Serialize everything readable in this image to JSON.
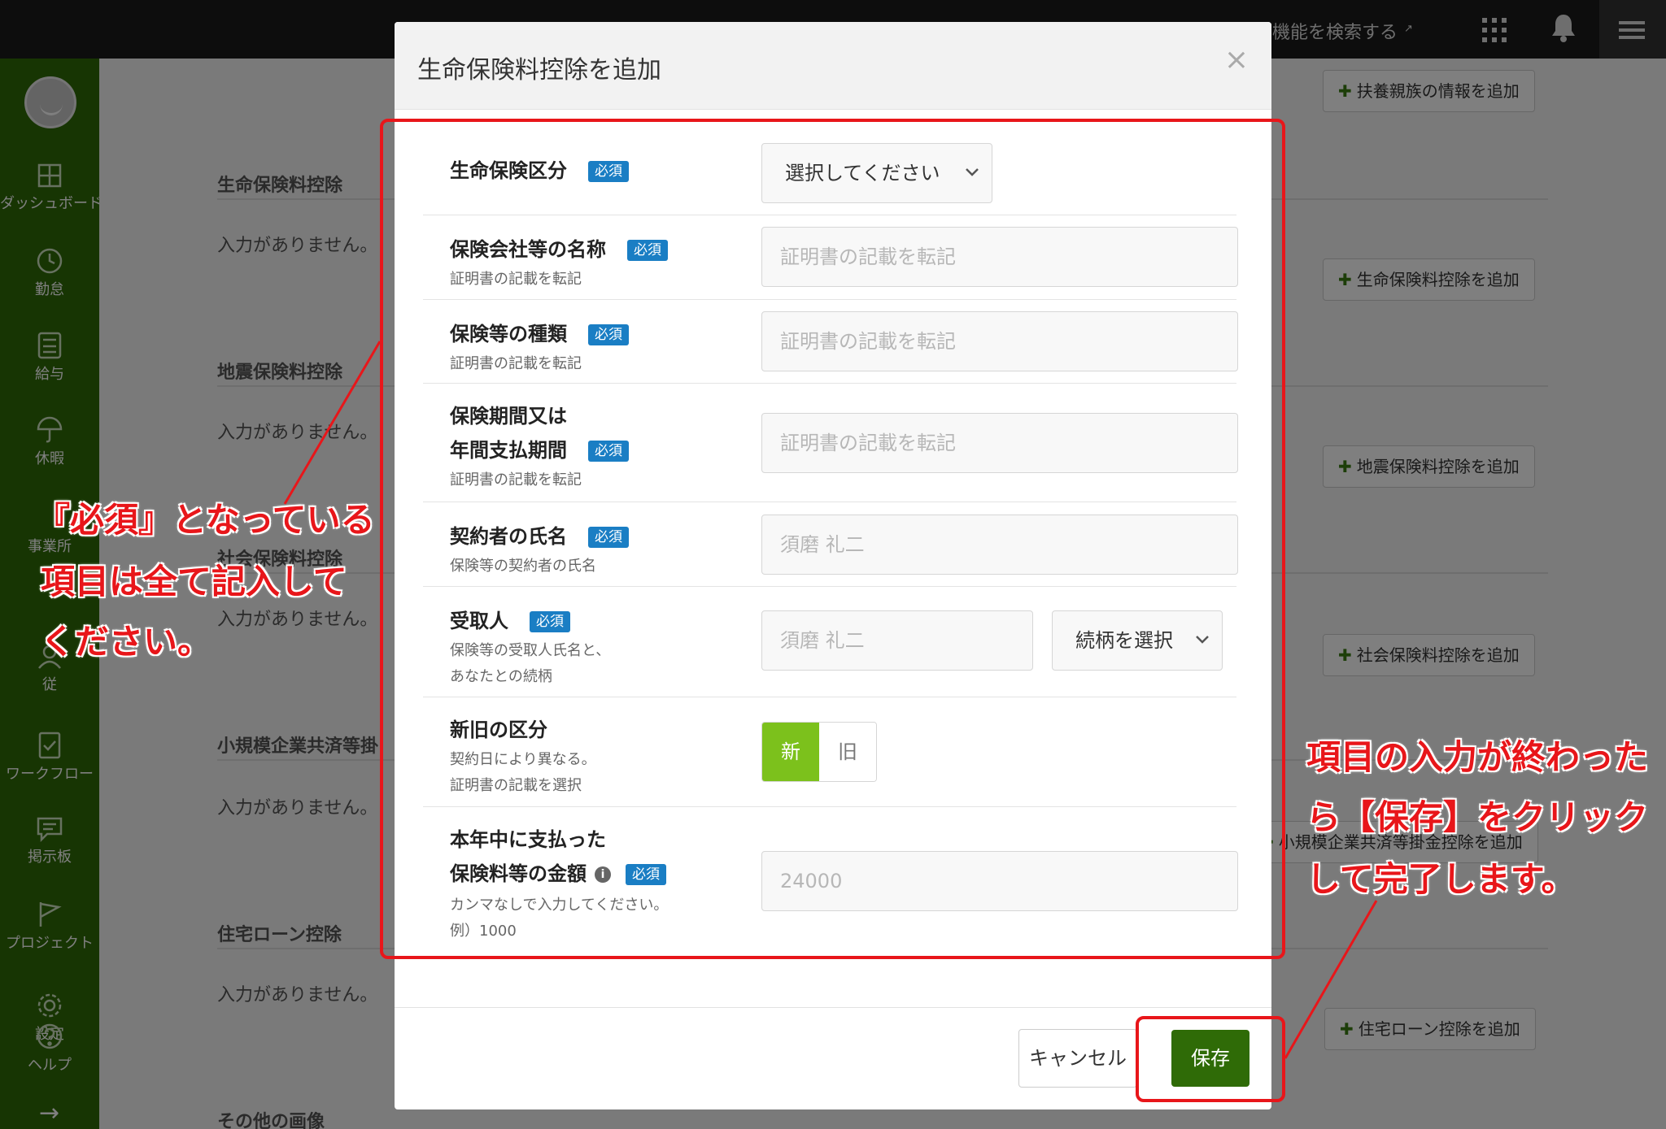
{
  "topbar": {
    "ext_link": "拡張機能を検索する",
    "ext_icon": "external-link-icon"
  },
  "sidebar": {
    "items": [
      {
        "label": "ダッシュボード",
        "icon": "dashboard-icon"
      },
      {
        "label": "勤怠",
        "icon": "clock-icon"
      },
      {
        "label": "給与",
        "icon": "calculator-icon"
      },
      {
        "label": "休暇",
        "icon": "umbrella-icon"
      },
      {
        "label": "事業所",
        "icon": "building-icon"
      },
      {
        "label": "従",
        "icon": "person-icon"
      },
      {
        "label": "ワークフロー",
        "icon": "workflow-icon"
      },
      {
        "label": "掲示板",
        "icon": "chat-icon"
      },
      {
        "label": "プロジェクト",
        "icon": "flag-icon"
      },
      {
        "label": "設定",
        "icon": "gear-icon"
      },
      {
        "label": "ヘルプ",
        "icon": "help-icon"
      }
    ]
  },
  "background": {
    "add_family": "扶養親族の情報を追加",
    "sections": [
      {
        "title": "生命保険料控除",
        "empty": "入力がありません。",
        "add": "生命保険料控除を追加"
      },
      {
        "title": "地震保険料控除",
        "empty": "入力がありません。",
        "add": "地震保険料控除を追加"
      },
      {
        "title": "社会保険料控除",
        "empty": "入力がありません。",
        "add": "社会保険料控除を追加"
      },
      {
        "title": "小規模企業共済等掛",
        "empty": "入力がありません。",
        "add": "小規模企業共済等掛金控除を追加"
      },
      {
        "title": "住宅ローン控除",
        "empty": "入力がありません。",
        "add": "住宅ローン控除を追加"
      },
      {
        "title": "その他の画像"
      }
    ]
  },
  "modal": {
    "title": "生命保険料控除を追加",
    "close": "×",
    "required_badge": "必須",
    "fields": {
      "category": {
        "label": "生命保険区分",
        "value": "選択してください"
      },
      "company": {
        "label": "保険会社等の名称",
        "sub": "証明書の記載を転記",
        "placeholder": "証明書の記載を転記"
      },
      "type": {
        "label": "保険等の種類",
        "sub": "証明書の記載を転記",
        "placeholder": "証明書の記載を転記"
      },
      "period": {
        "label1": "保険期間又は",
        "label2": "年間支払期間",
        "sub": "証明書の記載を転記",
        "placeholder": "証明書の記載を転記"
      },
      "contractor": {
        "label": "契約者の氏名",
        "sub": "保険等の契約者の氏名",
        "placeholder": "須磨 礼二"
      },
      "recipient": {
        "label": "受取人",
        "sub1": "保険等の受取人氏名と、",
        "sub2": "あなたとの続柄",
        "placeholder": "須磨 礼二",
        "relation": "続柄を選択"
      },
      "newold": {
        "label": "新旧の区分",
        "sub1": "契約日により異なる。",
        "sub2": "証明書の記載を選択",
        "new": "新",
        "old": "旧"
      },
      "amount": {
        "label1": "本年中に支払った",
        "label2": "保険料等の金額",
        "sub1": "カンマなしで入力してください。",
        "sub2": "例）1000",
        "placeholder": "24000"
      }
    },
    "cancel": "キャンセル",
    "save": "保存"
  },
  "annotations": {
    "left": [
      "『必須』となっている",
      "項目は全て記入して",
      "ください。"
    ],
    "right": [
      "項目の入力が終わった",
      "ら【保存】をクリック",
      "して完了します。"
    ],
    "color": "#e8161a"
  }
}
